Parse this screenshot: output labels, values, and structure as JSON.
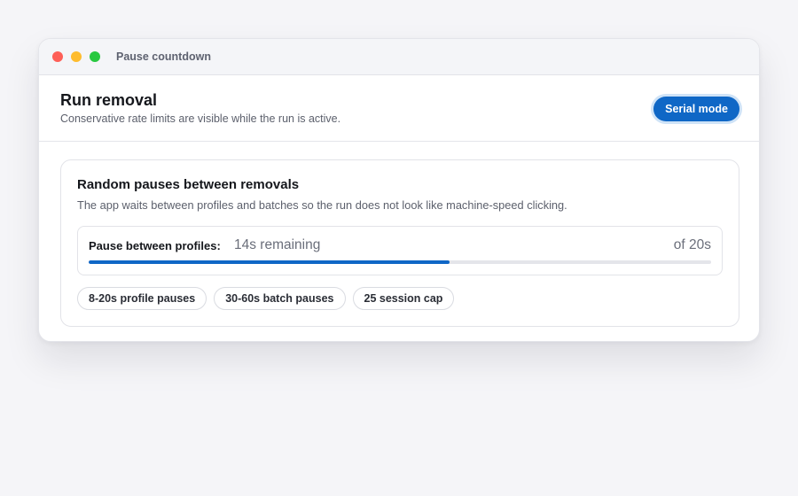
{
  "window": {
    "title": "Pause countdown"
  },
  "header": {
    "title": "Run removal",
    "subtitle": "Conservative rate limits are visible while the run is active.",
    "mode_button": "Serial mode"
  },
  "card": {
    "title": "Random pauses between removals",
    "description": "The app waits between profiles and batches so the run does not look like machine-speed clicking.",
    "countdown": {
      "label": "Pause between profiles:",
      "remaining": "14s remaining",
      "total": "of 20s",
      "progress_fraction": 0.58
    },
    "chips": [
      "8-20s profile pauses",
      "30-60s batch pauses",
      "25 session cap"
    ]
  },
  "colors": {
    "accent": "#0f67c6",
    "traffic_red": "#fe5f57",
    "traffic_yellow": "#febc2e",
    "traffic_green": "#28c840"
  }
}
